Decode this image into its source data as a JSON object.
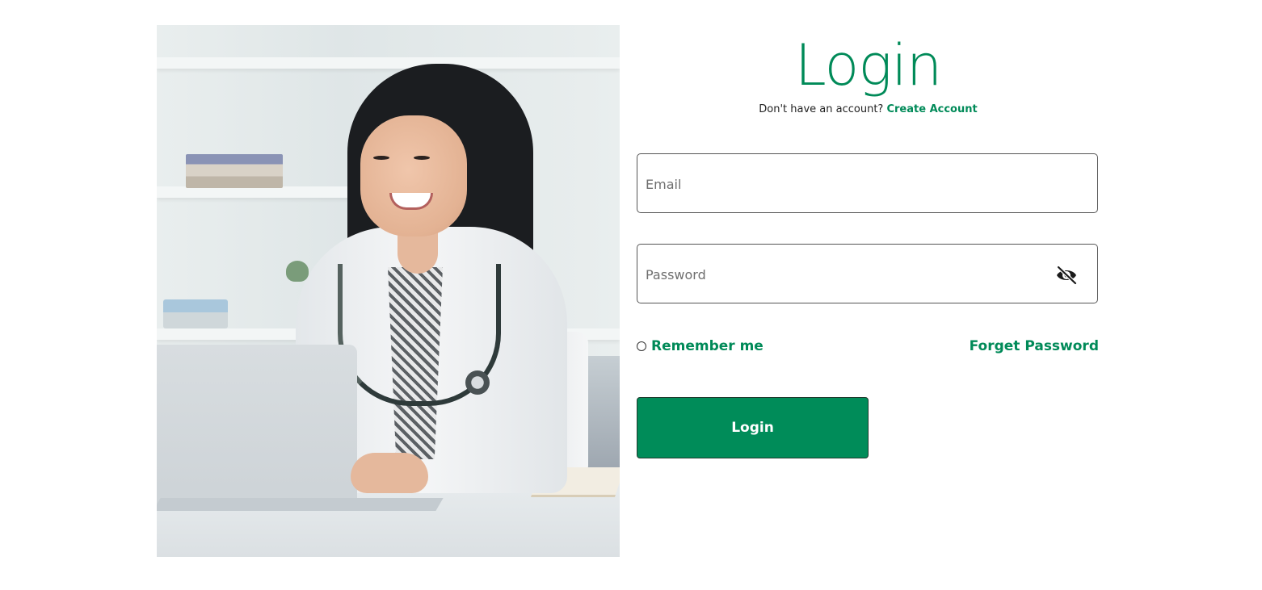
{
  "login": {
    "title": "Login",
    "prompt": "Don't have an account?",
    "create_account_link": "Create Account",
    "email": {
      "placeholder": "Email",
      "value": ""
    },
    "password": {
      "placeholder": "Password",
      "value": "",
      "toggle_icon": "eye-slash-icon"
    },
    "remember_me": {
      "label": "Remember me",
      "checked": false
    },
    "forget_password_link": "Forget Password",
    "submit_label": "Login"
  },
  "colors": {
    "accent": "#008a58",
    "button_bg": "#008c59",
    "button_text": "#ffffff"
  }
}
